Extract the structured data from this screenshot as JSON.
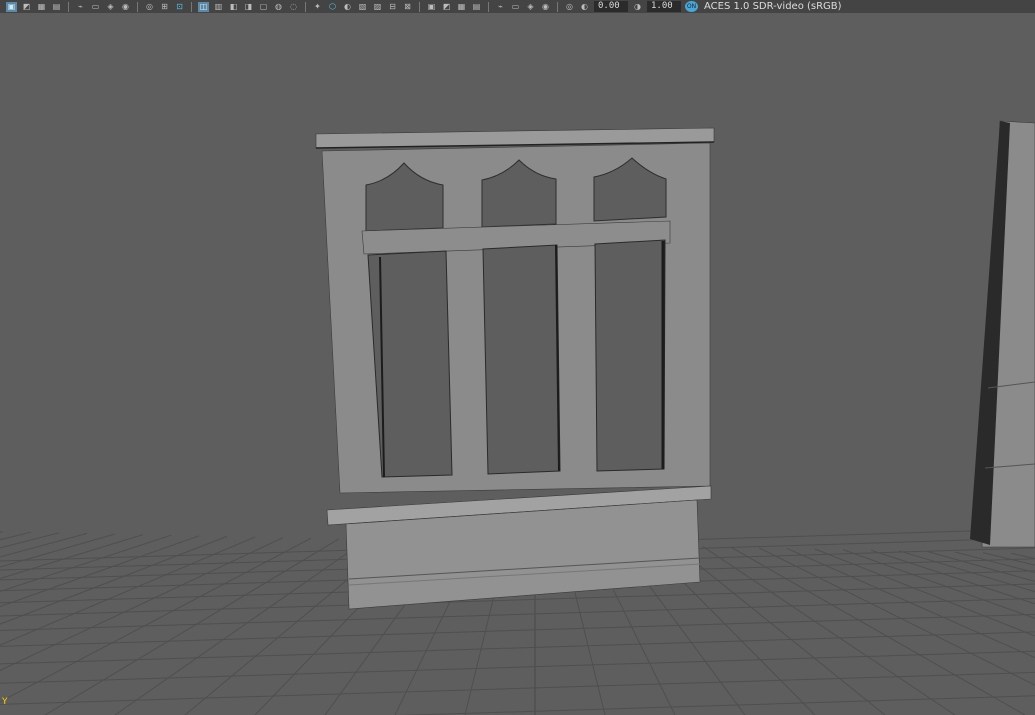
{
  "toolbar": {
    "exposure_value": "0.00",
    "gamma_value": "1.00",
    "color_badge": "ON",
    "colorspace_label": "ACES 1.0 SDR-video (sRGB)",
    "icons": [
      "select-icon",
      "lasso-icon",
      "paint-icon",
      "wire-icon",
      "sep",
      "camera-icon",
      "camera-attr-icon",
      "bookmark-camera-icon",
      "bookmark-icon",
      "sep",
      "image-plane-icon",
      "2d-pan-icon",
      "grease-pencil-icon",
      "sep",
      "grid-icon",
      "film-gate-icon",
      "resolution-gate-icon",
      "gate-mask-icon",
      "field-chart-icon",
      "safe-action-icon",
      "safe-title-icon",
      "sep",
      "wireframe-icon",
      "smooth-shade-icon",
      "default-material-icon",
      "wireframe-on-shaded-icon",
      "xray-icon",
      "use-lights-icon",
      "shadows-icon",
      "sep",
      "ssao-icon",
      "motion-blur-icon",
      "aa-icon",
      "dof-icon",
      "sep",
      "isolate-icon",
      "xray-joints-icon",
      "xray-active-icon",
      "backface-icon",
      "sep",
      "exposure-icon"
    ],
    "active_icons": [
      "grease-pencil-icon",
      "smooth-shade-icon"
    ],
    "on_icons": [
      "select-icon",
      "grid-icon"
    ]
  },
  "axis_label": "Y",
  "colors": {
    "background": "#5e5e5e",
    "toolbar": "#444444",
    "grid": "#4f4f4f",
    "model": "#8a8a8a",
    "accent": "#56c6e8"
  }
}
